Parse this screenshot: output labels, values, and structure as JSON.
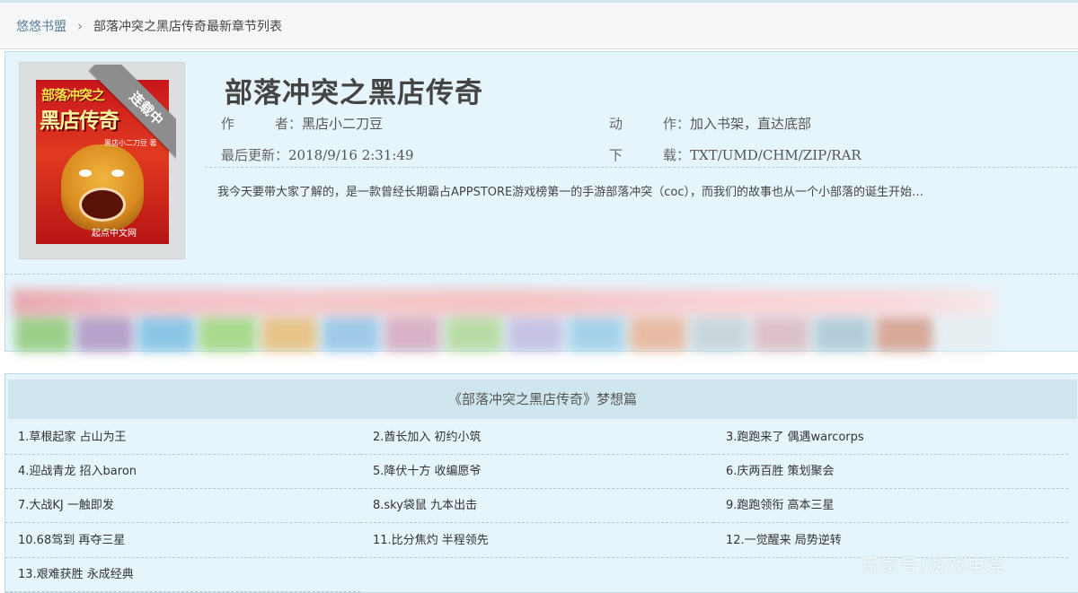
{
  "breadcrumb": {
    "home": "悠悠书盟",
    "separator": "›",
    "current": "部落冲突之黑店传奇最新章节列表"
  },
  "book": {
    "title": "部落冲突之黑店传奇",
    "status_ribbon": "连载中",
    "cover": {
      "line1": "部落冲突之",
      "line2": "黑店传奇",
      "author_small": "黑店小二刀豆 著",
      "brand": "起点中文网"
    },
    "author_label": "作　　　者：",
    "author_value": "黑店小二刀豆",
    "action_label": "动　　　作：",
    "action_value": "加入书架，直达底部",
    "updated_label": "最后更新：",
    "updated_value": "2018/9/16 2:31:49",
    "download_label": "下　　　载：",
    "download_value": "TXT/UMD/CHM/ZIP/RAR",
    "intro": "我今天要带大家了解的，是一款曾经长期霸占APPSTORE游戏榜第一的手游部落冲突（coc），而我们的故事也从一个小部落的诞生开始…"
  },
  "volume": {
    "title": "《部落冲突之黑店传奇》梦想篇"
  },
  "chapters": [
    [
      "1.草根起家 占山为王",
      "2.酋长加入 初约小筑",
      "3.跑跑来了 偶遇warcorps"
    ],
    [
      "4.迎战青龙 招入baron",
      "5.降伏十方 收编愿爷",
      "6.庆两百胜 策划聚会"
    ],
    [
      "7.大战KJ 一触即发",
      "8.sky袋鼠 九本出击",
      "9.跑跑领衔 高本三星"
    ],
    [
      "10.68驾到 再夺三星",
      "11.比分焦灼 半程领先",
      "12.一觉醒来 局势逆转"
    ],
    [
      "13.艰难获胜 永成经典",
      "",
      ""
    ]
  ],
  "watermark": "百家号/游戏电竞",
  "colors": {
    "panel": "#e5f5fb",
    "header": "#cfe6ee",
    "link": "#5b7d97"
  }
}
